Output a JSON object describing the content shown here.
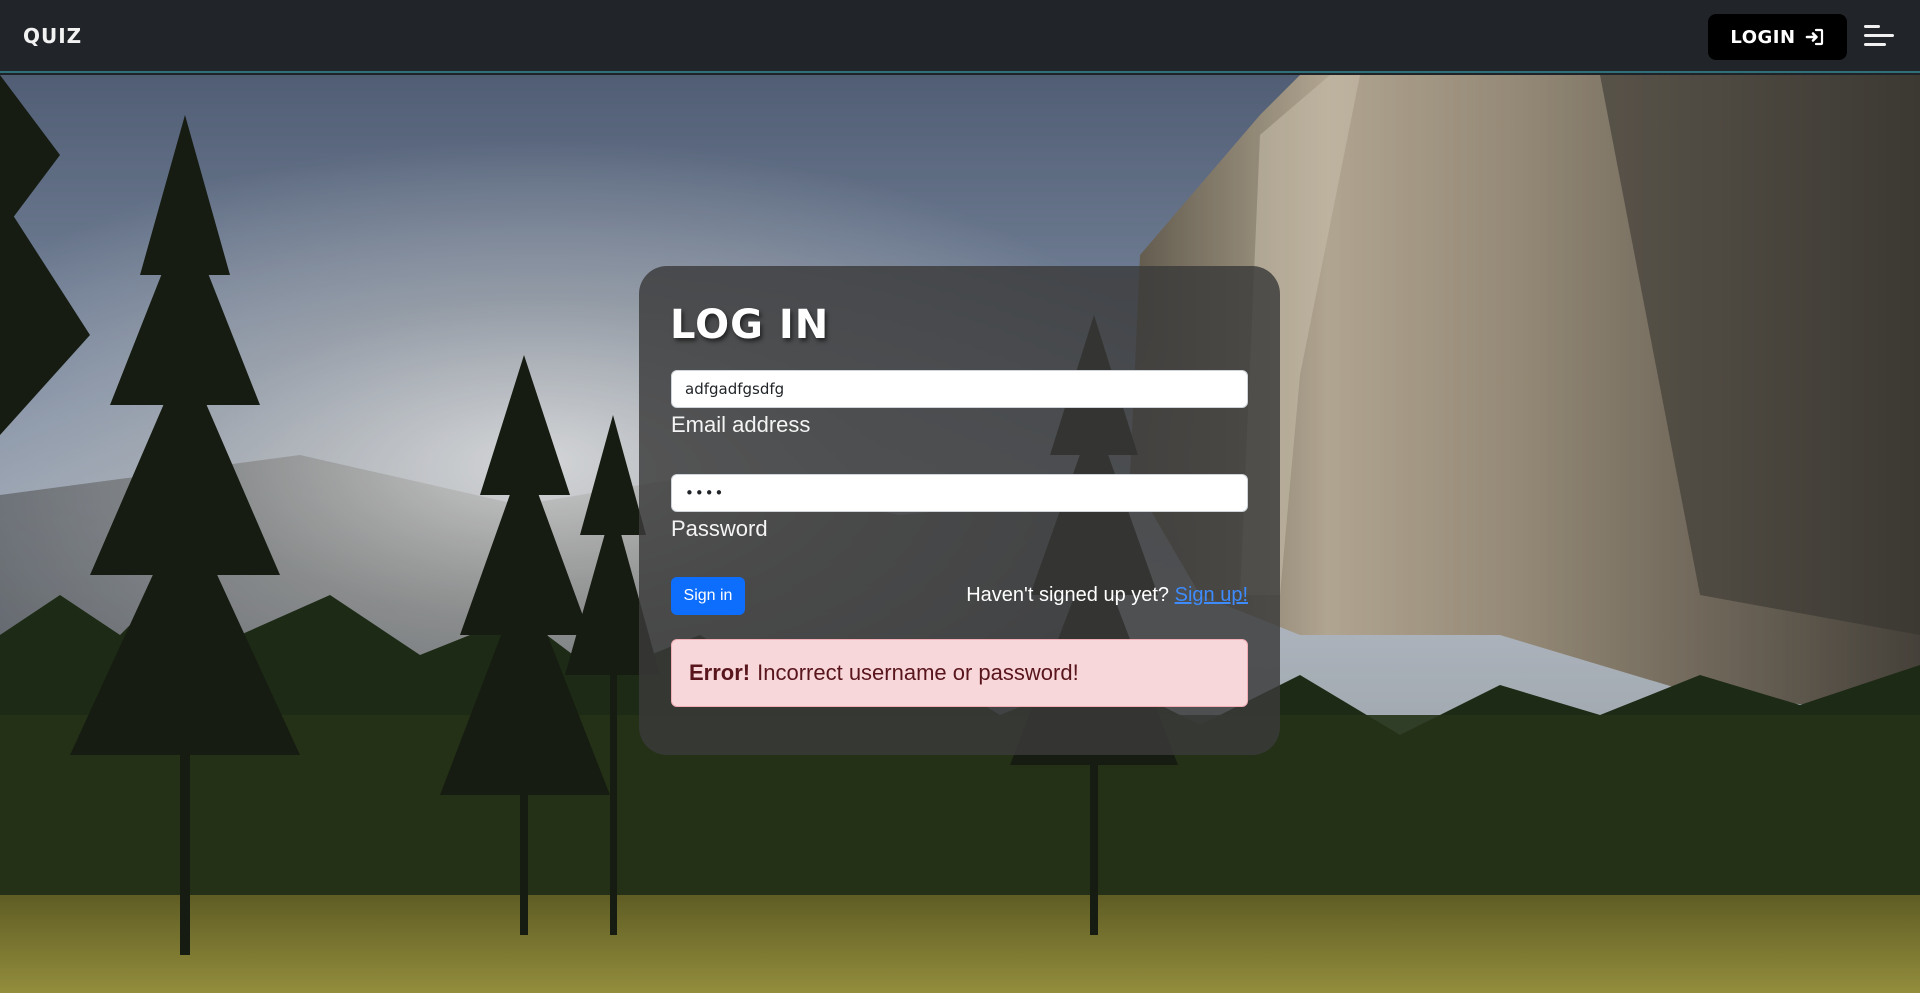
{
  "navbar": {
    "brand": "QUIZ",
    "login_label": "LOGIN",
    "login_icon": "sign-in-icon",
    "menu_icon": "hamburger-menu-icon"
  },
  "login_form": {
    "title": "LOG IN",
    "email": {
      "value": "adfgadfgsdfg",
      "label": "Email address"
    },
    "password": {
      "value": "••••",
      "label": "Password"
    },
    "signin_label": "Sign in",
    "signup_prompt": "Haven't signed up yet?",
    "signup_link": "Sign up!",
    "error": {
      "strong": "Error!",
      "message": "Incorrect username or password!"
    }
  },
  "colors": {
    "navbar_bg": "#212429",
    "primary_button": "#0d6efd",
    "link": "#3d8bfd",
    "alert_bg": "#f8d7da",
    "alert_text": "#58151c"
  }
}
